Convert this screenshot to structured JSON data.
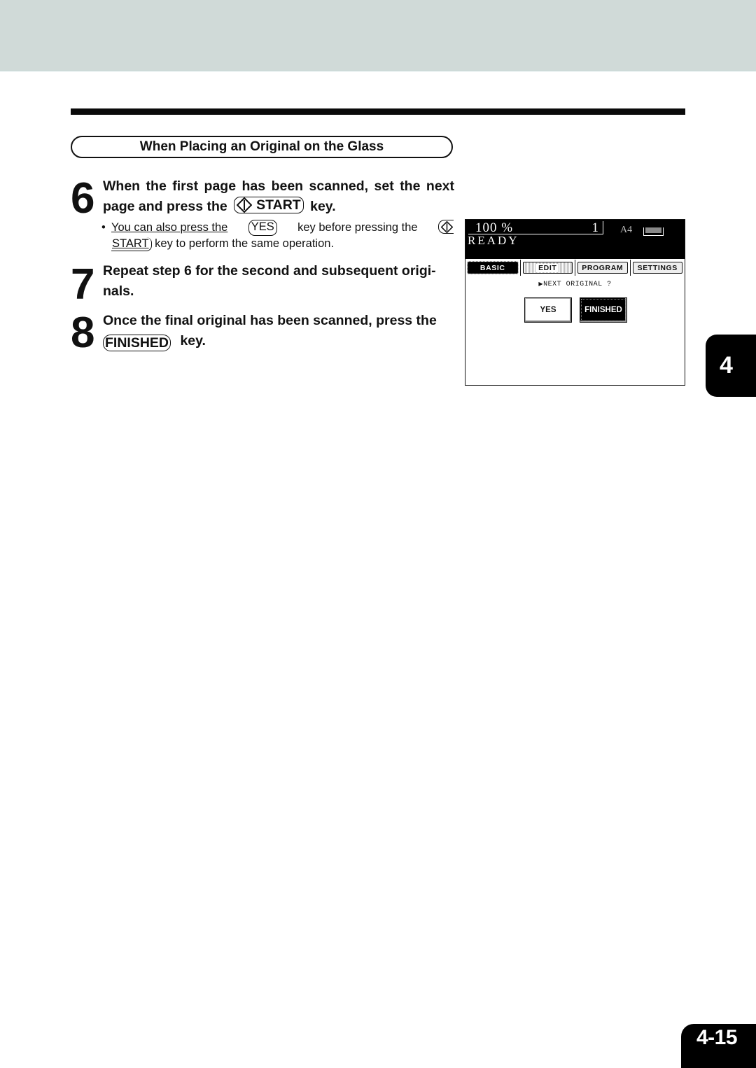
{
  "header": {
    "band_color": "#d0dad8"
  },
  "section": {
    "title": "When Placing an Original on the Glass"
  },
  "steps": [
    {
      "number": "6",
      "text_before": "When the first page has been scanned, set the next page and press the",
      "key_label": "START",
      "key_icon": "start-diamond-icon",
      "text_after": "key.",
      "note": {
        "bullet": "•",
        "part1": "You can also press the",
        "key_yes": "YES",
        "part2": "key before pressing the",
        "key_start": "START",
        "part3": "key to perform the same operation."
      }
    },
    {
      "number": "7",
      "text": "Repeat step 6 for the second and subsequent originals.",
      "line1": "Repeat step 6 for the second and subsequent origi-",
      "line2": "nals."
    },
    {
      "number": "8",
      "text_before": "Once the final original has been scanned, press the",
      "key_label": "FINISHED",
      "text_after": "key."
    }
  ],
  "panel": {
    "ratio": "100 %",
    "count": "1",
    "status": "READY",
    "paper_size": "A4",
    "tray_icon": "paper-tray-icon",
    "tabs": [
      {
        "label": "BASIC",
        "active": true
      },
      {
        "label": "EDIT",
        "active": false
      },
      {
        "label": "PROGRAM",
        "active": false
      },
      {
        "label": "SETTINGS",
        "active": false
      }
    ],
    "prompt_arrow": "▶",
    "prompt": "NEXT ORIGINAL ?",
    "buttons": {
      "yes": "YES",
      "finished": "FINISHED"
    }
  },
  "chapter_tab": "4",
  "page_number": "4-15"
}
